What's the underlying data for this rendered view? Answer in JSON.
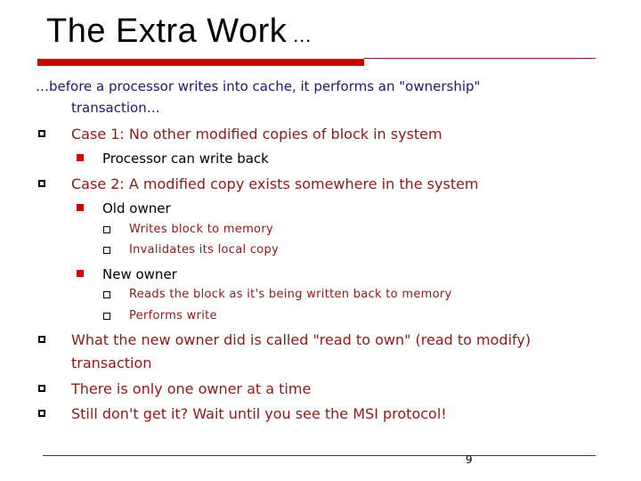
{
  "slide": {
    "title": "The Extra Work",
    "title_ellipsis": "…",
    "intro": [
      "…before a processor writes into cache, it performs an \"ownership\"",
      "transaction…"
    ],
    "bullets": [
      {
        "text": "Case 1:  No other modified copies of block in system"
      },
      {
        "text": "Processor can write back"
      },
      {
        "text": "Case 2: A modified copy exists somewhere in the system"
      },
      {
        "text": "Old owner"
      },
      {
        "text": "Writes block  to memory"
      },
      {
        "text": "Invalidates its local copy"
      },
      {
        "text": "New owner"
      },
      {
        "text": "Reads the block as it's being written back to memory"
      },
      {
        "text": "Performs write"
      },
      {
        "text": "What the new owner did is called \"read to own\" (read to modify)"
      },
      {
        "text": "transaction"
      },
      {
        "text": "There is only one owner at a time"
      },
      {
        "text": "Still don't get it? Wait until you see the MSI protocol!"
      }
    ],
    "page_number": "9",
    "colors": {
      "accent_red": "#cc0000",
      "text_darkred": "#8b1a1a",
      "intro_blue": "#1a1a6e"
    }
  }
}
